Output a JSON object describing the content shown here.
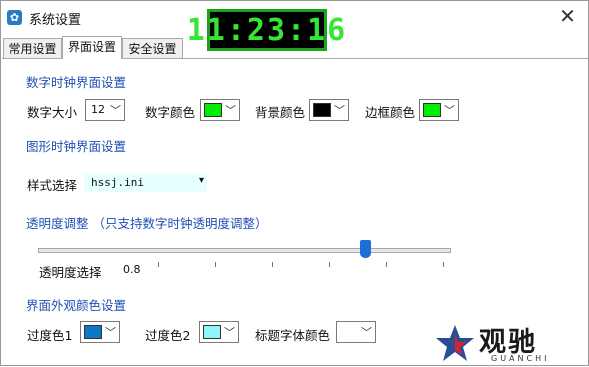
{
  "window": {
    "title": "系统设置",
    "clock": "11:23:16"
  },
  "tabs": [
    {
      "label": "常用设置"
    },
    {
      "label": "界面设置"
    },
    {
      "label": "安全设置"
    }
  ],
  "digital_clock": {
    "heading": "数字时钟界面设置",
    "size_label": "数字大小",
    "size_value": "12",
    "digit_color_label": "数字颜色",
    "digit_color": "#00ee00",
    "bg_color_label": "背景颜色",
    "bg_color": "#000000",
    "border_color_label": "边框颜色",
    "border_color": "#00ee00"
  },
  "graphic_clock": {
    "heading": "图形时钟界面设置",
    "style_label": "样式选择",
    "style_value": "hssj.ini"
  },
  "opacity": {
    "heading": "透明度调整  （只支持数字时钟透明度调整）",
    "label": "透明度选择",
    "value_text": "0.8",
    "value": 0.8
  },
  "appearance": {
    "heading": "界面外观颜色设置",
    "gradient1_label": "过度色1",
    "gradient1_color": "#0b78c9",
    "gradient2_label": "过度色2",
    "gradient2_color": "#8ef6f6",
    "title_font_color_label": "标题字体颜色",
    "title_font_color": "#ffffff"
  },
  "watermark": {
    "cn": "观驰",
    "en": "GUANCHI"
  }
}
